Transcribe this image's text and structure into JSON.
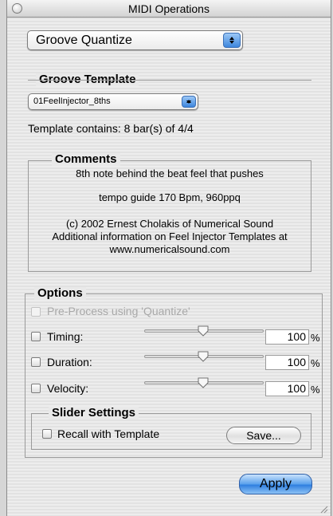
{
  "window": {
    "title": "MIDI Operations"
  },
  "operation_popup": {
    "selected": "Groove Quantize"
  },
  "groove_template": {
    "heading": "Groove Template",
    "selected": "01FeelInjector_8ths",
    "contains_text": "Template contains: 8 bar(s) of 4/4"
  },
  "comments": {
    "heading": "Comments",
    "line1": "8th note behind the beat feel that pushes",
    "line2": "tempo guide 170 Bpm, 960ppq",
    "line3": "(c) 2002  Ernest Cholakis of Numerical Sound",
    "line4": "Additional information on Feel Injector Templates at",
    "line5": "www.numericalsound.com"
  },
  "options": {
    "heading": "Options",
    "preprocess_label": "Pre-Process using 'Quantize'",
    "timing": {
      "label": "Timing:",
      "value": "100",
      "unit": "%"
    },
    "duration": {
      "label": "Duration:",
      "value": "100",
      "unit": "%"
    },
    "velocity": {
      "label": "Velocity:",
      "value": "100",
      "unit": "%"
    }
  },
  "slider_settings": {
    "heading": "Slider Settings",
    "recall_label": "Recall with Template",
    "save_label": "Save..."
  },
  "apply_label": "Apply"
}
